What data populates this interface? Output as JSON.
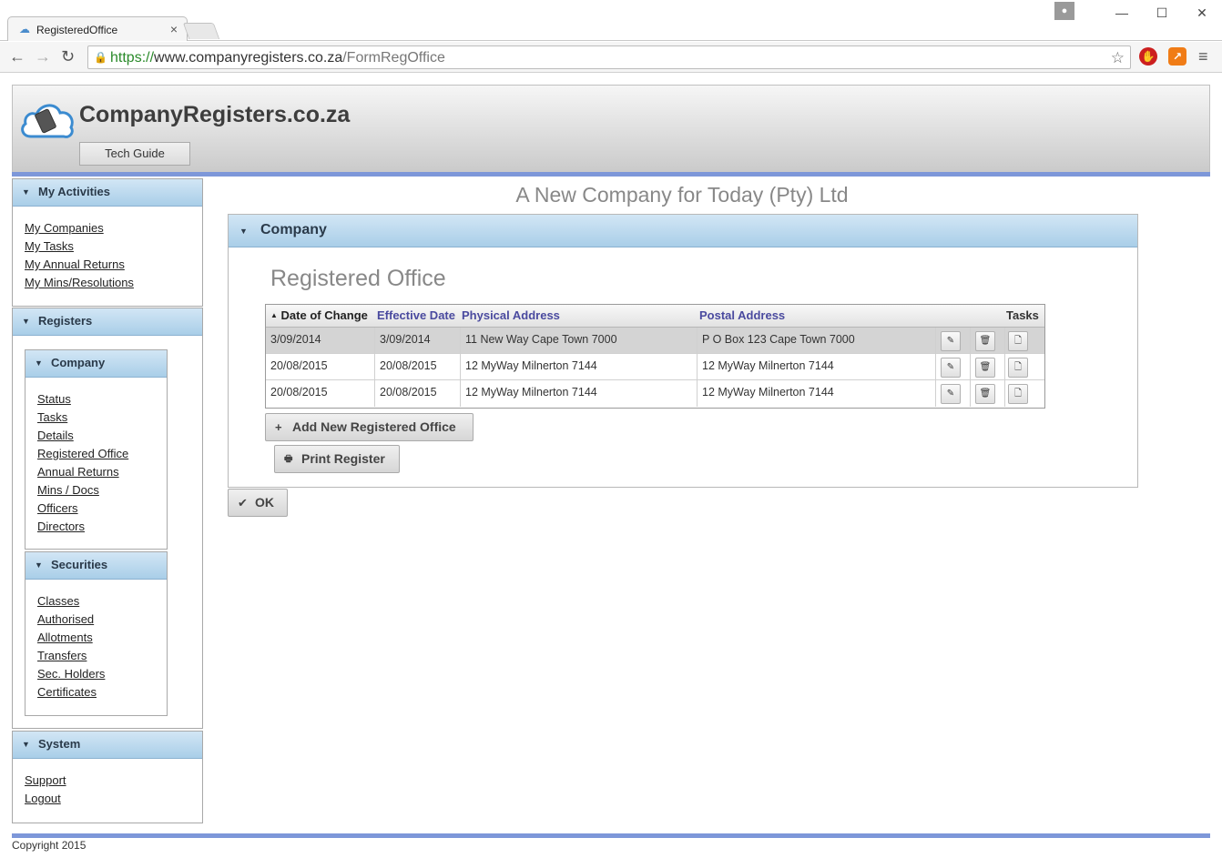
{
  "browser": {
    "tab_title": "RegisteredOffice",
    "url_scheme": "https://",
    "url_host": "www.companyregisters.co.za",
    "url_path": "/FormRegOffice"
  },
  "header": {
    "site_title": "CompanyRegisters.co.za",
    "tech_guide": "Tech Guide"
  },
  "sidebar": {
    "my_activities": {
      "title": "My Activities",
      "links": [
        "My Companies",
        "My Tasks",
        "My Annual Returns",
        "My Mins/Resolutions"
      ]
    },
    "registers": {
      "title": "Registers",
      "company": {
        "title": "Company",
        "links": [
          "Status",
          "Tasks",
          "Details",
          "Registered Office",
          "Annual Returns",
          "Mins / Docs",
          "Officers",
          "Directors"
        ]
      },
      "securities": {
        "title": "Securities",
        "links": [
          "Classes",
          "Authorised",
          "Allotments",
          "Transfers",
          "Sec. Holders",
          "Certificates"
        ]
      }
    },
    "system": {
      "title": "System",
      "links": [
        "Support",
        "Logout"
      ]
    }
  },
  "main": {
    "company_name": "A New Company for Today (Pty) Ltd",
    "panel_title": "Company",
    "section_title": "Registered Office",
    "columns": [
      "Date of Change",
      "Effective Date",
      "Physical Address",
      "Postal Address",
      "Tasks"
    ],
    "rows": [
      {
        "date_of_change": "3/09/2014",
        "effective_date": "3/09/2014",
        "physical": "11 New Way Cape Town 7000",
        "postal": "P O Box 123 Cape Town 7000"
      },
      {
        "date_of_change": "20/08/2015",
        "effective_date": "20/08/2015",
        "physical": "12 MyWay Milnerton 7144",
        "postal": "12 MyWay Milnerton 7144"
      },
      {
        "date_of_change": "20/08/2015",
        "effective_date": "20/08/2015",
        "physical": "12 MyWay Milnerton 7144",
        "postal": "12 MyWay Milnerton 7144"
      }
    ],
    "add_button": "Add New Registered Office",
    "print_button": "Print Register",
    "ok_button": "OK"
  },
  "footer": {
    "copyright": "Copyright 2015"
  },
  "colors": {
    "accent_bar": "#7d97d9",
    "panel_header": "#a9cee8",
    "header_link": "#4a4a9f"
  }
}
